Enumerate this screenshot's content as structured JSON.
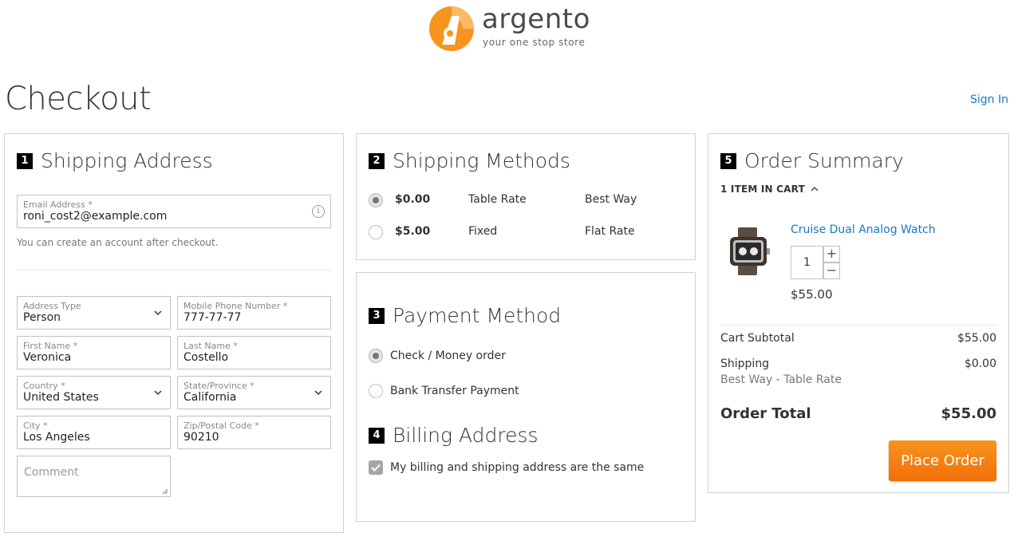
{
  "brand": {
    "name": "argento",
    "tagline": "your one stop store",
    "accent_color": "#f26f0a"
  },
  "page": {
    "title": "Checkout",
    "sign_in_label": "Sign In"
  },
  "shipping_address": {
    "step_number": "1",
    "title": "Shipping Address",
    "email": {
      "label": "Email Address",
      "value": "roni_cost2@example.com",
      "icon": "info-icon"
    },
    "email_hint": "You can create an account after checkout.",
    "fields": {
      "address_type": {
        "label": "Address Type",
        "value": "Person"
      },
      "mobile_phone": {
        "label": "Mobile Phone Number",
        "value": "777-77-77"
      },
      "first_name": {
        "label": "First Name",
        "value": "Veronica"
      },
      "last_name": {
        "label": "Last Name",
        "value": "Costello"
      },
      "country": {
        "label": "Country",
        "value": "United States"
      },
      "state": {
        "label": "State/Province",
        "value": "California"
      },
      "city": {
        "label": "City",
        "value": "Los Angeles"
      },
      "zip": {
        "label": "Zip/Postal Code",
        "value": "90210"
      }
    },
    "comment_placeholder": "Comment",
    "required_marker": "*"
  },
  "shipping_methods": {
    "step_number": "2",
    "title": "Shipping Methods",
    "options": [
      {
        "price": "$0.00",
        "method": "Table Rate",
        "carrier": "Best Way",
        "selected": true
      },
      {
        "price": "$5.00",
        "method": "Fixed",
        "carrier": "Flat Rate",
        "selected": false
      }
    ]
  },
  "payment_method": {
    "step_number": "3",
    "title": "Payment Method",
    "options": [
      {
        "label": "Check / Money order",
        "selected": true
      },
      {
        "label": "Bank Transfer Payment",
        "selected": false
      }
    ]
  },
  "billing_address": {
    "step_number": "4",
    "title": "Billing Address",
    "same_as_shipping_label": "My billing and shipping address are the same",
    "same_as_shipping_checked": true
  },
  "order_summary": {
    "step_number": "5",
    "title": "Order Summary",
    "items_in_cart_label": "1 ITEM IN CART",
    "item": {
      "name": "Cruise Dual Analog Watch",
      "qty": "1",
      "price": "$55.00",
      "image": "watch-image"
    },
    "cart_subtotal_label": "Cart Subtotal",
    "cart_subtotal_value": "$55.00",
    "shipping_label": "Shipping",
    "shipping_value": "$0.00",
    "shipping_method": "Best Way - Table Rate",
    "order_total_label": "Order Total",
    "order_total_value": "$55.00",
    "place_order_label": "Place Order"
  }
}
